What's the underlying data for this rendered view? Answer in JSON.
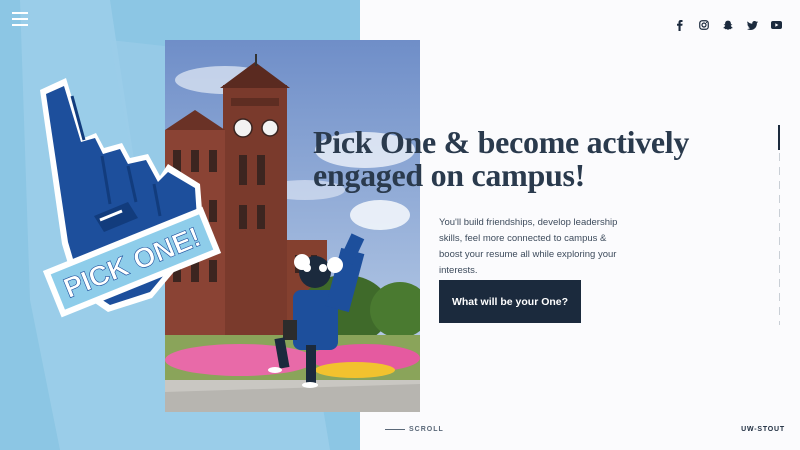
{
  "header": {
    "menu_icon": "hamburger-icon",
    "social": [
      {
        "name": "facebook",
        "icon": "facebook-icon"
      },
      {
        "name": "instagram",
        "icon": "instagram-icon"
      },
      {
        "name": "snapchat",
        "icon": "snapchat-icon"
      },
      {
        "name": "twitter",
        "icon": "twitter-icon"
      },
      {
        "name": "youtube",
        "icon": "youtube-icon"
      }
    ]
  },
  "hero": {
    "foam_finger_text": "PICK ONE!",
    "headline_line1": "Pick One & become actively",
    "headline_line2": "engaged on campus!",
    "body": "You'll build friendships, develop leadership skills, feel more connected to campus & boost your resume all while exploring your interests.",
    "cta_label": "What will be your One?"
  },
  "footer": {
    "scroll_label": "SCROLL",
    "brand": "UW-STOUT"
  },
  "colors": {
    "left_panel": "#8cc6e4",
    "foam_blue": "#1d4f9c",
    "foam_light": "#8ecdea",
    "dark_navy": "#1b2a3d",
    "heading": "#2a3a4d",
    "background": "#fbfbfd"
  }
}
